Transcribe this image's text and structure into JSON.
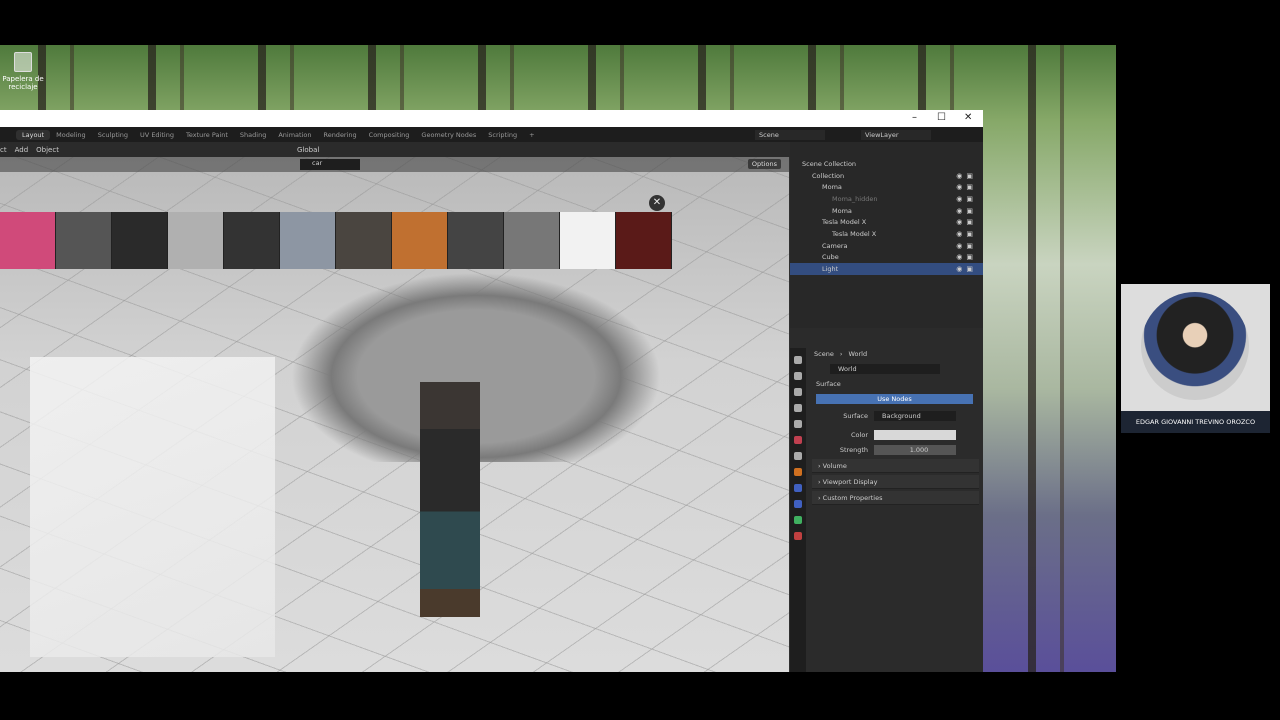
{
  "desktop": {
    "recycle_bin": "Papelera de reciclaje"
  },
  "window": {
    "controls": [
      "–",
      "☐",
      "✕"
    ]
  },
  "workspaces": [
    "Layout",
    "Modeling",
    "Sculpting",
    "UV Editing",
    "Texture Paint",
    "Shading",
    "Animation",
    "Rendering",
    "Compositing",
    "Geometry Nodes",
    "Scripting",
    "+"
  ],
  "active_workspace": "Layout",
  "scene": "Scene",
  "view_layer": "ViewLayer",
  "header": {
    "menus": [
      "ct",
      "Add",
      "Object"
    ],
    "transform": "Global"
  },
  "viewport": {
    "search_value": "car",
    "options": "Options",
    "close": "✕"
  },
  "outliner": {
    "items": [
      {
        "label": "Scene Collection",
        "indent": 0
      },
      {
        "label": "Collection",
        "indent": 1
      },
      {
        "label": "Moma",
        "indent": 2
      },
      {
        "label": "Moma_hidden",
        "indent": 3
      },
      {
        "label": "Moma",
        "indent": 3
      },
      {
        "label": "Tesla Model X",
        "indent": 2
      },
      {
        "label": "Tesla Model X",
        "indent": 3
      },
      {
        "label": "Camera",
        "indent": 2
      },
      {
        "label": "Cube",
        "indent": 2
      },
      {
        "label": "Light",
        "indent": 2,
        "selected": true
      }
    ]
  },
  "properties": {
    "breadcrumb": [
      "Scene",
      "World"
    ],
    "world_name": "World",
    "surface_panel": "Surface",
    "use_nodes": "Use Nodes",
    "surface_label": "Surface",
    "surface_value": "Background",
    "color_label": "Color",
    "strength_label": "Strength",
    "strength_value": "1.000",
    "panels": [
      "Volume",
      "Viewport Display",
      "Custom Properties"
    ],
    "accent": "#4772b3"
  },
  "webcam": {
    "name": "EDGAR GIOVANNI TREVINO OROZCO"
  }
}
